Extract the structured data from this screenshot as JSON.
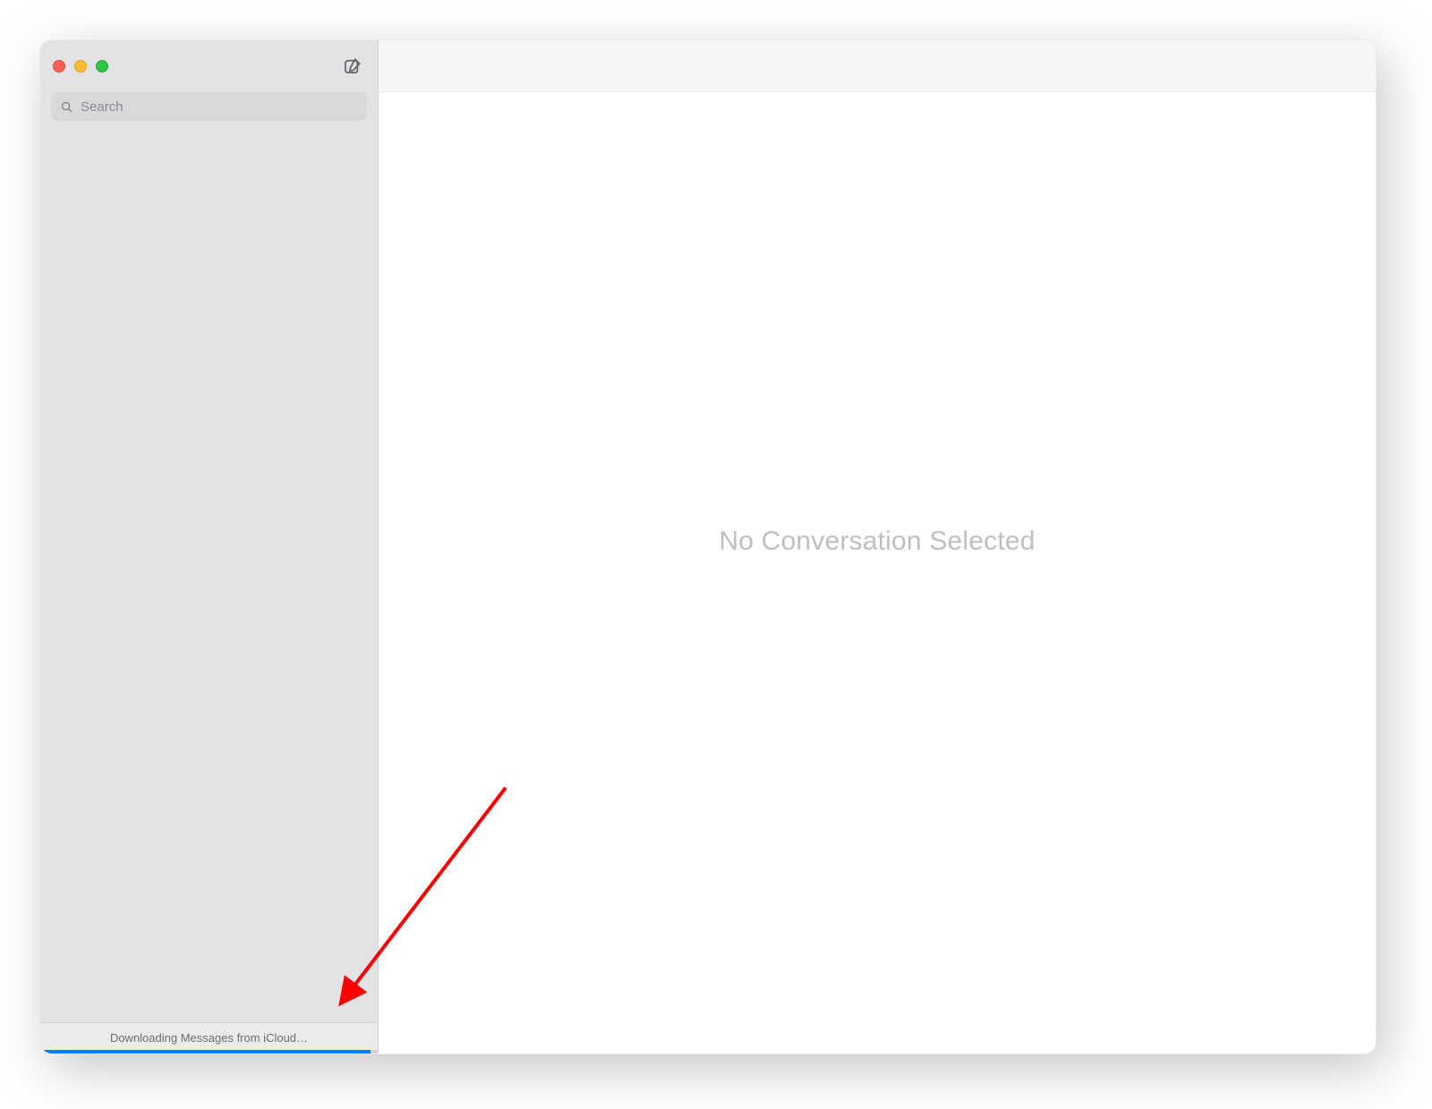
{
  "window": {
    "traffic_lights": {
      "close_color": "#ff5f57",
      "minimize_color": "#febc2e",
      "maximize_color": "#28c840"
    },
    "compose_icon": "compose-icon"
  },
  "sidebar": {
    "search": {
      "placeholder": "Search",
      "icon": "search-icon",
      "value": ""
    },
    "status": {
      "text": "Downloading Messages from iCloud…",
      "progress_percent": 98,
      "progress_color": "#0a7aff"
    }
  },
  "main": {
    "placeholder": "No Conversation Selected"
  },
  "annotation": {
    "arrow_color": "#ff0000"
  }
}
